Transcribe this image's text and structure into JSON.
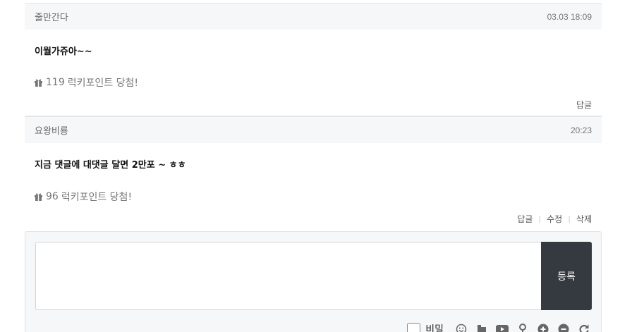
{
  "comments": [
    {
      "author": "줄만간다",
      "date": "03.03 18:09",
      "body": "이월가쥬아~~",
      "lucky_points": "119",
      "lucky_text": "럭키포인트 당첨!",
      "actions": {
        "reply": "답글"
      }
    },
    {
      "author": "요왕비룡",
      "date": "20:23",
      "body": "지금 댓글에 대댓글 달면 2만포 ~ ㅎㅎ",
      "lucky_points": "96",
      "lucky_text": "럭키포인트 당첨!",
      "actions": {
        "reply": "답글",
        "edit": "수정",
        "delete": "삭제"
      }
    }
  ],
  "write": {
    "submit_label": "등록",
    "secret_label": "비밀",
    "textarea_value": ""
  },
  "icons": [
    "gift-icon",
    "emoticon-icon",
    "image-icon",
    "video-icon",
    "map-pin-icon",
    "zoom-in-icon",
    "zoom-out-icon",
    "refresh-icon"
  ],
  "colors": {
    "header_bg": "#f6f7f8",
    "button_bg": "#343a40",
    "muted_text": "#777777"
  }
}
